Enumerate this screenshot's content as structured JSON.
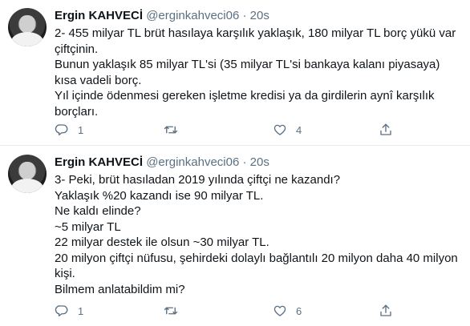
{
  "tweets": [
    {
      "name": "Ergin KAHVECİ",
      "handle": "@erginkahveci06",
      "separator": "·",
      "time": "20s",
      "lines": [
        "2- 455 milyar TL brüt hasılaya karşılık yaklaşık, 180 milyar TL borç yükü var çiftçinin.",
        "Bunun yaklaşık 85 milyar TL'si (35 milyar TL'si bankaya kalanı piyasaya) kısa vadeli borç.",
        "Yıl içinde ödenmesi gereken  işletme kredisi ya da girdilerin aynî karşılık borçları."
      ],
      "reply_count": "1",
      "retweet_count": "",
      "like_count": "4"
    },
    {
      "name": "Ergin KAHVECİ",
      "handle": "@erginkahveci06",
      "separator": "·",
      "time": "20s",
      "lines": [
        "3- Peki, brüt hasıladan 2019 yılında çiftçi ne kazandı?",
        "Yaklaşık %20 kazandı ise 90 milyar TL.",
        "Ne kaldı elinde?",
        "~5 milyar TL",
        "22 milyar destek ile olsun ~30 milyar TL.",
        "20 milyon çiftçi nüfusu, şehirdeki dolaylı bağlantılı 20 milyon daha 40 milyon kişi.",
        "Bilmem anlatabildim mi?"
      ],
      "reply_count": "1",
      "retweet_count": "",
      "like_count": "6"
    }
  ],
  "icons": {
    "reply": "reply-icon",
    "retweet": "retweet-icon",
    "like": "heart-icon",
    "share": "share-icon"
  },
  "colors": {
    "text": "#0f1419",
    "secondary": "#5b7083",
    "divider": "#e6ecf0"
  }
}
